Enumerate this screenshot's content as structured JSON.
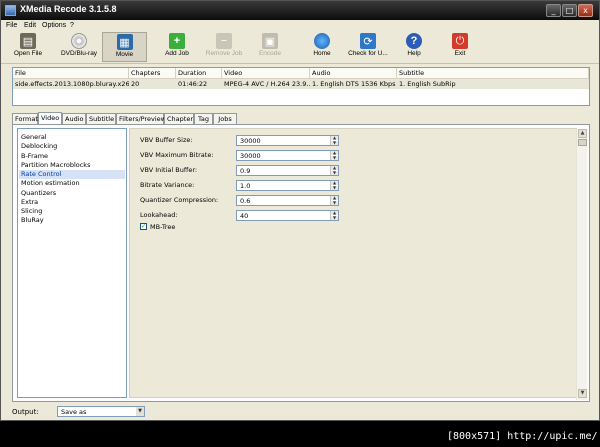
{
  "window": {
    "title": "XMedia Recode 3.1.5.8"
  },
  "titlebar_buttons": {
    "min": "_",
    "max": "□",
    "close": "x"
  },
  "menu": [
    "File",
    "Edit",
    "Options",
    "?"
  ],
  "toolbar": [
    {
      "label": "Open File",
      "icon": "open-file-icon",
      "state": "enabled"
    },
    {
      "label": "DVD/Blu-ray",
      "icon": "disc-icon",
      "state": "enabled"
    },
    {
      "label": "Movie",
      "icon": "film-icon",
      "state": "active"
    },
    {
      "label": "Add Job",
      "icon": "add-icon",
      "state": "enabled"
    },
    {
      "label": "Remove Job",
      "icon": "remove-icon",
      "state": "disabled"
    },
    {
      "label": "Encode",
      "icon": "encode-icon",
      "state": "disabled"
    },
    {
      "label": "Home",
      "icon": "globe-icon",
      "state": "enabled"
    },
    {
      "label": "Check for U...",
      "icon": "refresh-icon",
      "state": "enabled"
    },
    {
      "label": "Help",
      "icon": "help-icon",
      "state": "enabled"
    },
    {
      "label": "Exit",
      "icon": "exit-icon",
      "state": "enabled"
    }
  ],
  "filelist": {
    "columns": [
      "File",
      "Chapters",
      "Duration",
      "Video",
      "Audio",
      "Subtitle"
    ],
    "rows": [
      [
        "side.effects.2013.1080p.bluray.x26...",
        "20",
        "01:46:22",
        "MPEG-4 AVC / H.264 23.9...",
        "1. English DTS 1536 Kbps ...",
        "1. English SubRip"
      ]
    ]
  },
  "tabs": [
    "Format",
    "Video",
    "Audio",
    "Subtitle",
    "Filters/Preview",
    "Chapter",
    "Tag",
    "Jobs"
  ],
  "active_tab": "Video",
  "video_sections": [
    "General",
    "Deblocking",
    "B-Frame",
    "Partition Macroblocks",
    "Rate Control",
    "Motion estimation",
    "Quantizers",
    "Extra",
    "Slicing",
    "BluRay"
  ],
  "selected_section": "Rate Control",
  "rate_control": [
    {
      "label": "VBV Buffer Size:",
      "value": "30000"
    },
    {
      "label": "VBV Maximum Bitrate:",
      "value": "30000"
    },
    {
      "label": "VBV Initial Buffer:",
      "value": "0.9"
    },
    {
      "label": "Bitrate Variance:",
      "value": "1.0"
    },
    {
      "label": "Quantizer Compression:",
      "value": "0.6"
    },
    {
      "label": "Lookahead:",
      "value": "40"
    }
  ],
  "mb_tree": {
    "label": "MB-Tree",
    "checked": true,
    "mark": "✓"
  },
  "spin_arrows": {
    "up": "▲",
    "down": "▼"
  },
  "scroll_arrows": {
    "up": "▲",
    "down": "▼"
  },
  "output": {
    "label": "Output:",
    "value": "Save as",
    "arrow": "▼"
  },
  "watermark": "[800x571] http://upic.me/",
  "colors": {
    "titlebar": "#1a1a1a",
    "selection": "#d6e2f5",
    "window": "#ece9d8"
  }
}
